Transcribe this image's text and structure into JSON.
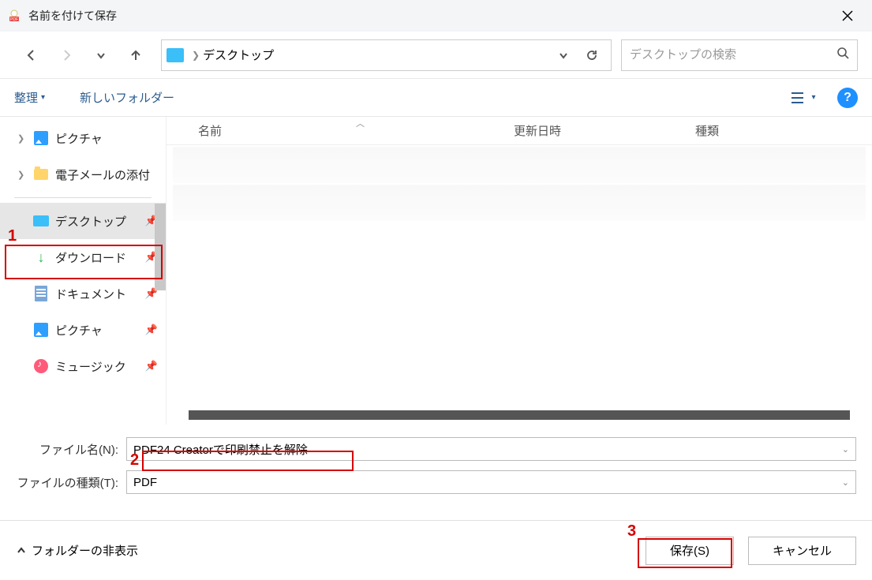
{
  "title": "名前を付けて保存",
  "nav": {
    "breadcrumb_location": "デスクトップ"
  },
  "search": {
    "placeholder": "デスクトップの検索"
  },
  "toolbar": {
    "organize": "整理",
    "new_folder": "新しいフォルダー"
  },
  "sidebar": {
    "items": [
      {
        "label": "ピクチャ",
        "icon": "pic",
        "expandable": true
      },
      {
        "label": "電子メールの添付",
        "icon": "folder",
        "expandable": true
      },
      {
        "label": "デスクトップ",
        "icon": "monitor",
        "pinned": true,
        "selected": true
      },
      {
        "label": "ダウンロード",
        "icon": "download",
        "pinned": true
      },
      {
        "label": "ドキュメント",
        "icon": "doc",
        "pinned": true
      },
      {
        "label": "ピクチャ",
        "icon": "pic",
        "pinned": true
      },
      {
        "label": "ミュージック",
        "icon": "music",
        "pinned": true
      }
    ]
  },
  "columns": {
    "name": "名前",
    "date": "更新日時",
    "type": "種類"
  },
  "form": {
    "filename_label": "ファイル名(N):",
    "filename_value": "PDF24 Creatorで印刷禁止を解除",
    "filetype_label": "ファイルの種類(T):",
    "filetype_value": "PDF"
  },
  "footer": {
    "hide_folders": "フォルダーの非表示",
    "save": "保存(S)",
    "cancel": "キャンセル"
  },
  "annotations": {
    "a1": "1",
    "a2": "2",
    "a3": "3"
  }
}
